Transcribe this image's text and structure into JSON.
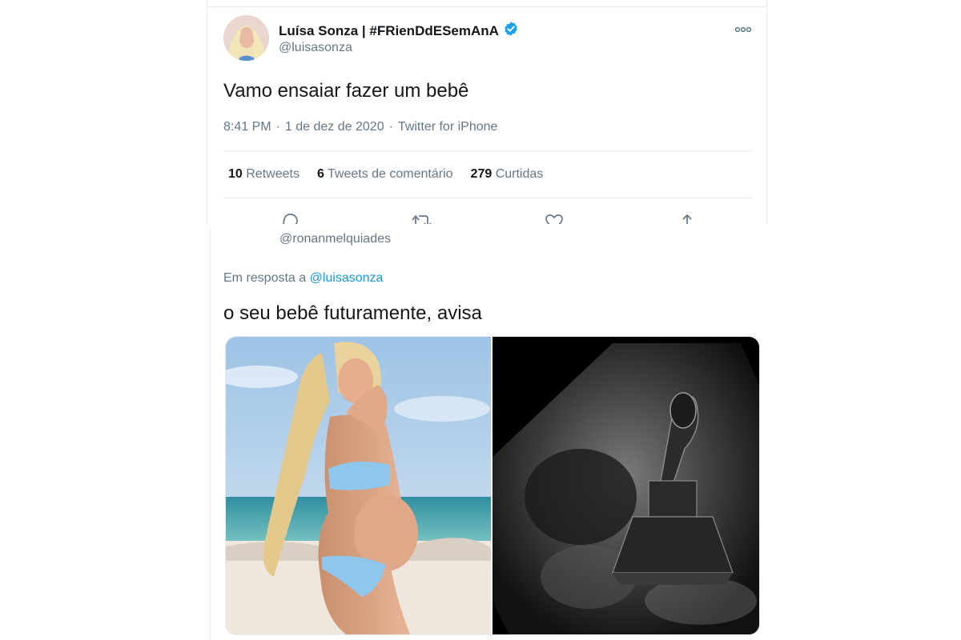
{
  "original_tweet": {
    "author_name": "Luísa Sonza | #FRienDdESemAnA",
    "handle": "@luisasonza",
    "text": "Vamo ensaiar fazer um bebê",
    "time": "8:41 PM",
    "date": "1 de dez de 2020",
    "source": "Twitter for iPhone",
    "separator": "·",
    "stats": {
      "retweets_count": "10",
      "retweets_label": "Retweets",
      "comments_count": "6",
      "comments_label": "Tweets de comentário",
      "likes_count": "279",
      "likes_label": "Curtidas"
    },
    "icons": [
      "verified-badge-icon",
      "more-options-icon",
      "reply-icon",
      "retweet-icon",
      "like-icon",
      "share-icon"
    ]
  },
  "reply_tweet": {
    "handle": "@ronanmelquiades",
    "in_reply_prefix": "Em resposta a",
    "in_reply_mention": "@luisasonza",
    "text": "o seu bebê futuramente, avisa",
    "media": [
      "beach-pregnancy-photo",
      "ultrasound-grammy-image"
    ]
  },
  "colors": {
    "text_primary": "#14171a",
    "text_secondary": "#657786",
    "link": "#1b95e0",
    "verified": "#1da1f2",
    "border": "#e6ecf0"
  }
}
